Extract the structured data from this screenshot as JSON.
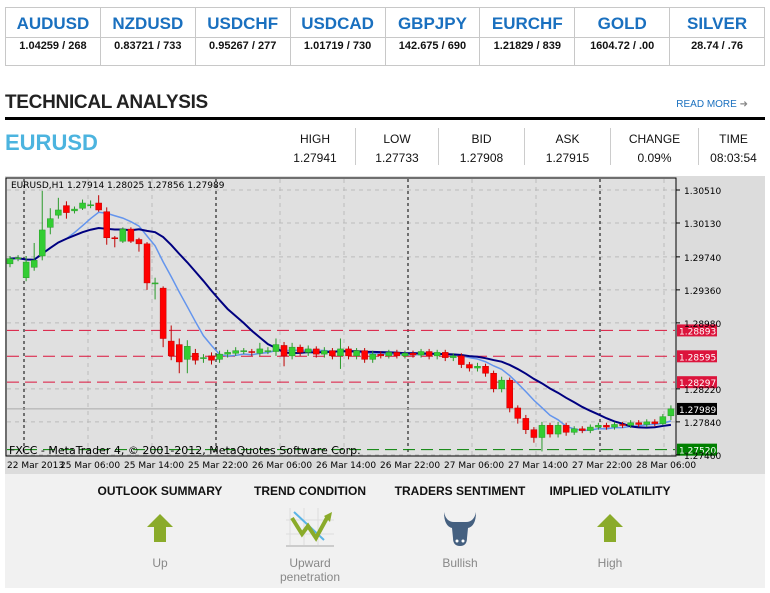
{
  "quotes": [
    {
      "symbol": "AUDUSD",
      "value": "1.04259 / 268"
    },
    {
      "symbol": "NZDUSD",
      "value": "0.83721 / 733"
    },
    {
      "symbol": "USDCHF",
      "value": "0.95267 / 277"
    },
    {
      "symbol": "USDCAD",
      "value": "1.01719 / 730"
    },
    {
      "symbol": "GBPJPY",
      "value": "142.675 / 690"
    },
    {
      "symbol": "EURCHF",
      "value": "1.21829 / 839"
    },
    {
      "symbol": "GOLD",
      "value": "1604.72 / .00"
    },
    {
      "symbol": "SILVER",
      "value": "28.74 / .76"
    }
  ],
  "section": {
    "title": "TECHNICAL ANALYSIS",
    "read_more": "READ MORE",
    "read_more_icon": "arrow-right"
  },
  "instrument": {
    "symbol": "EURUSD",
    "stats": [
      {
        "label": "HIGH",
        "value": "1.27941"
      },
      {
        "label": "LOW",
        "value": "1.27733"
      },
      {
        "label": "BID",
        "value": "1.27908"
      },
      {
        "label": "ASK",
        "value": "1.27915"
      },
      {
        "label": "CHANGE",
        "value": "0.09%"
      },
      {
        "label": "TIME",
        "value": "08:03:54"
      }
    ]
  },
  "chart_data": {
    "type": "candlestick",
    "header": "EURUSD,H1  1.27914 1.28025 1.27856 1.27989",
    "watermark": "FXCC - MetaTrader 4, © 2001-2012, MetaQuotes Software Corp.",
    "ylim": [
      1.2746,
      1.306
    ],
    "y_ticks": [
      "1.30510",
      "1.30130",
      "1.29740",
      "1.29360",
      "1.28980",
      "1.28220",
      "1.27840",
      "1.27460"
    ],
    "x_ticks": [
      "22 Mar 2013",
      "25 Mar 06:00",
      "25 Mar 14:00",
      "25 Mar 22:00",
      "26 Mar 06:00",
      "26 Mar 14:00",
      "26 Mar 22:00",
      "27 Mar 06:00",
      "27 Mar 14:00",
      "27 Mar 22:00",
      "28 Mar 06:00"
    ],
    "levels": [
      {
        "value": "1.28893",
        "color": "#dc143c"
      },
      {
        "value": "1.28595",
        "color": "#dc143c"
      },
      {
        "value": "1.28297",
        "color": "#dc143c"
      },
      {
        "value": "1.27520",
        "color": "#008000"
      }
    ],
    "bid_line": {
      "value": "1.27989",
      "color": "#000000"
    },
    "colors": {
      "up": "#32cd32",
      "down": "#ff0000",
      "ma_fast": "#6495ed",
      "ma_slow": "#000080"
    },
    "candles": [
      [
        1.2966,
        1.2975,
        1.2962,
        1.2972
      ],
      [
        1.2972,
        1.2976,
        1.2969,
        1.2973
      ],
      [
        1.295,
        1.2975,
        1.2946,
        1.2968
      ],
      [
        1.2962,
        1.299,
        1.2958,
        1.297
      ],
      [
        1.2975,
        1.305,
        1.297,
        1.3005
      ],
      [
        1.3008,
        1.303,
        1.3,
        1.3018
      ],
      [
        1.3022,
        1.3042,
        1.3018,
        1.3028
      ],
      [
        1.3033,
        1.3038,
        1.3018,
        1.3025
      ],
      [
        1.3027,
        1.3032,
        1.3024,
        1.3029
      ],
      [
        1.303,
        1.304,
        1.3028,
        1.3036
      ],
      [
        1.3034,
        1.3039,
        1.303,
        1.3034
      ],
      [
        1.3036,
        1.3045,
        1.3026,
        1.3028
      ],
      [
        1.3026,
        1.3031,
        1.2988,
        1.2996
      ],
      [
        1.2996,
        1.2998,
        1.2985,
        1.2995
      ],
      [
        1.2992,
        1.3008,
        1.299,
        1.3006
      ],
      [
        1.3006,
        1.3008,
        1.299,
        1.2992
      ],
      [
        1.2994,
        1.2996,
        1.298,
        1.2989
      ],
      [
        1.2989,
        1.2991,
        1.2936,
        1.2944
      ],
      [
        1.2944,
        1.295,
        1.2925,
        1.2944
      ],
      [
        1.2938,
        1.294,
        1.287,
        1.288
      ],
      [
        1.2877,
        1.2895,
        1.2855,
        1.286
      ],
      [
        1.2873,
        1.288,
        1.284,
        1.2853
      ],
      [
        1.2856,
        1.2878,
        1.284,
        1.2871
      ],
      [
        1.2863,
        1.2868,
        1.285,
        1.2855
      ],
      [
        1.2858,
        1.2862,
        1.2852,
        1.2858
      ],
      [
        1.286,
        1.2864,
        1.285,
        1.2855
      ],
      [
        1.2856,
        1.2866,
        1.2852,
        1.2862
      ],
      [
        1.2862,
        1.2867,
        1.2858,
        1.2864
      ],
      [
        1.2863,
        1.287,
        1.286,
        1.2866
      ],
      [
        1.2866,
        1.2869,
        1.2862,
        1.2866
      ],
      [
        1.2865,
        1.2868,
        1.286,
        1.2864
      ],
      [
        1.2863,
        1.2875,
        1.286,
        1.2868
      ],
      [
        1.2866,
        1.287,
        1.2862,
        1.2866
      ],
      [
        1.2865,
        1.288,
        1.286,
        1.2873
      ],
      [
        1.2872,
        1.2876,
        1.2848,
        1.286
      ],
      [
        1.286,
        1.2875,
        1.2856,
        1.287
      ],
      [
        1.287,
        1.2873,
        1.286,
        1.2864
      ],
      [
        1.2864,
        1.2872,
        1.286,
        1.2868
      ],
      [
        1.2868,
        1.2871,
        1.2858,
        1.2862
      ],
      [
        1.2862,
        1.287,
        1.2858,
        1.2866
      ],
      [
        1.2866,
        1.2869,
        1.2856,
        1.286
      ],
      [
        1.286,
        1.288,
        1.2845,
        1.2868
      ],
      [
        1.2868,
        1.2871,
        1.2856,
        1.286
      ],
      [
        1.286,
        1.2869,
        1.2856,
        1.2866
      ],
      [
        1.2866,
        1.2869,
        1.2852,
        1.2856
      ],
      [
        1.2856,
        1.2866,
        1.2852,
        1.2862
      ],
      [
        1.2862,
        1.2865,
        1.2857,
        1.286
      ],
      [
        1.286,
        1.2867,
        1.2857,
        1.2864
      ],
      [
        1.2864,
        1.2867,
        1.2857,
        1.286
      ],
      [
        1.286,
        1.2866,
        1.2857,
        1.2863
      ],
      [
        1.2863,
        1.2866,
        1.2858,
        1.2861
      ],
      [
        1.2861,
        1.2868,
        1.2858,
        1.2865
      ],
      [
        1.2865,
        1.2868,
        1.2856,
        1.286
      ],
      [
        1.286,
        1.2867,
        1.2856,
        1.2864
      ],
      [
        1.2864,
        1.2867,
        1.2854,
        1.2858
      ],
      [
        1.2858,
        1.2863,
        1.2854,
        1.286
      ],
      [
        1.286,
        1.2863,
        1.2846,
        1.285
      ],
      [
        1.285,
        1.2853,
        1.2842,
        1.2846
      ],
      [
        1.2846,
        1.2852,
        1.2842,
        1.2848
      ],
      [
        1.2848,
        1.2851,
        1.2836,
        1.284
      ],
      [
        1.284,
        1.2843,
        1.2818,
        1.2822
      ],
      [
        1.2822,
        1.2836,
        1.2818,
        1.2832
      ],
      [
        1.2832,
        1.2835,
        1.2795,
        1.28
      ],
      [
        1.28,
        1.2803,
        1.2782,
        1.2788
      ],
      [
        1.2788,
        1.2792,
        1.277,
        1.2775
      ],
      [
        1.2775,
        1.2778,
        1.276,
        1.2766
      ],
      [
        1.2766,
        1.2784,
        1.275,
        1.278
      ],
      [
        1.278,
        1.2783,
        1.2766,
        1.277
      ],
      [
        1.277,
        1.2784,
        1.2766,
        1.278
      ],
      [
        1.278,
        1.2783,
        1.2768,
        1.2772
      ],
      [
        1.2772,
        1.2779,
        1.2769,
        1.2776
      ],
      [
        1.2776,
        1.2779,
        1.2771,
        1.2774
      ],
      [
        1.2774,
        1.2781,
        1.2771,
        1.2778
      ],
      [
        1.2778,
        1.2783,
        1.2775,
        1.278
      ],
      [
        1.278,
        1.2783,
        1.2775,
        1.2778
      ],
      [
        1.2778,
        1.2784,
        1.2775,
        1.2781
      ],
      [
        1.2781,
        1.2784,
        1.2777,
        1.278
      ],
      [
        1.278,
        1.2786,
        1.2777,
        1.2783
      ],
      [
        1.2783,
        1.2786,
        1.2778,
        1.2781
      ],
      [
        1.2781,
        1.2787,
        1.2778,
        1.2784
      ],
      [
        1.2784,
        1.2787,
        1.2779,
        1.2782
      ],
      [
        1.2782,
        1.2793,
        1.278,
        1.279
      ],
      [
        1.2791,
        1.2803,
        1.2786,
        1.2799
      ]
    ]
  },
  "indicators": [
    {
      "heading": "OUTLOOK SUMMARY",
      "icon": "arrow-up",
      "value": "Up"
    },
    {
      "heading": "TREND CONDITION",
      "icon": "trend-chart",
      "value": "Upward penetration"
    },
    {
      "heading": "TRADERS SENTIMENT",
      "icon": "bull",
      "value": "Bullish"
    },
    {
      "heading": "IMPLIED VOLATILITY",
      "icon": "arrow-up",
      "value": "High"
    }
  ]
}
